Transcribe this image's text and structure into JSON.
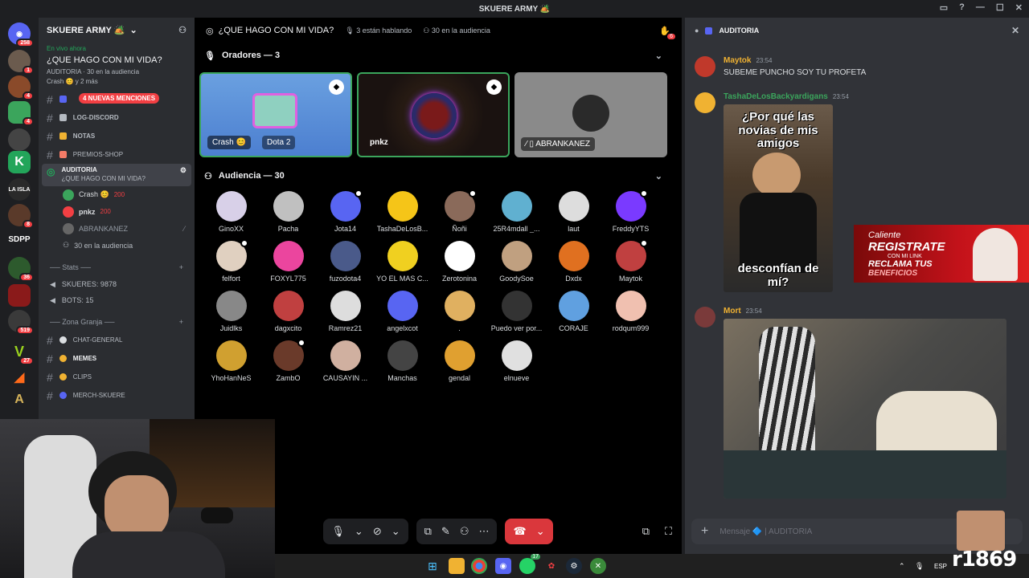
{
  "window": {
    "title": "SKUERE ARMY 🏕️"
  },
  "rail": {
    "badges": [
      "258",
      "1",
      "4",
      "4",
      "8",
      "36",
      "519",
      "27"
    ],
    "sdpp": "SDPP"
  },
  "server": {
    "name": "SKUERE ARMY 🏕️"
  },
  "live": {
    "status": "En vivo ahora",
    "title": "¿QUE HAGO CON MI VIDA?",
    "channel": "AUDITORIA",
    "audience": "30 en la audiencia",
    "speakers": "Crash 😊 y 2 más"
  },
  "channels": {
    "mentions": "4 NUEVAS MENCIONES",
    "items": [
      "LOG-DISCORD",
      "NOTAS",
      "PREMIOS-SHOP"
    ],
    "active": {
      "name": "AUDITORIA",
      "topic": "¿QUE HAGO CON MI VIDA?"
    },
    "voice_users": [
      "Crash 😊",
      "pnkz",
      "ABRANKANEZ"
    ],
    "voice_badges": [
      "200",
      "200"
    ],
    "voice_audience": "30 en la audiencia",
    "cat_stats": "Stats",
    "stats": [
      "SKUERES: 9878",
      "BOTS: 15"
    ],
    "cat_zona": "Zona Granja",
    "zona": [
      "CHAT-GENERAL",
      "MEMES",
      "CLIPS",
      "MERCH-SKUERE"
    ]
  },
  "stage": {
    "title": "¿QUE HAGO CON MI VIDA?",
    "talking": "3 están hablando",
    "audience": "30 en la audiencia",
    "hand_count": "6",
    "speakers_header": "Oradores — 3",
    "speakers": [
      {
        "name": "Crash 😊",
        "extra": "Dota 2"
      },
      {
        "name": "pnkz"
      },
      {
        "name": "ABRANKANEZ"
      }
    ],
    "audience_header": "Audiencia — 30",
    "audience_list": [
      "GinoXX",
      "Pacha",
      "Jota14",
      "TashaDeLosB...",
      "Ñoñi",
      "25R4mdall _...",
      "laut",
      "FreddyYTS",
      "felfort",
      "FOXYL775",
      "fuzodota4",
      "YO EL MAS C...",
      "Zerotonina",
      "GoodySoe",
      "Dxdx",
      "Maytok",
      "Juidlks",
      "dagxcito",
      "Ramrez21",
      "angelxcot",
      ".",
      "Puedo ver por...",
      "CORAJE",
      "rodqum999",
      "YhoHanNeS",
      "ZambO",
      "CAUSAYIN ...",
      "Manchas",
      "gendal",
      "elnueve"
    ]
  },
  "chat": {
    "channel": "AUDITORIA",
    "messages": [
      {
        "user": "Maytok",
        "time": "23:54",
        "text": "SUBEME PUNCHO SOY TU PROFETA",
        "color": "#f0b232"
      },
      {
        "user": "TashaDeLosBackyardigans",
        "time": "23:54",
        "text": "",
        "color": "#3ba55c",
        "meme_top": "¿Por qué las novias de mis amigos",
        "meme_bottom": "desconfían de mí?"
      },
      {
        "user": "Mort",
        "time": "23:54",
        "text": "",
        "color": "#f0b232"
      }
    ],
    "placeholder": "Mensaje 🔷 | AUDITORIA"
  },
  "ad": {
    "line1": "Caliente",
    "line2": "REGISTRATE",
    "line3": "CON MI LINK",
    "line4": "RECLAMA TUS",
    "line5": "BENEFICIOS"
  },
  "taskbar": {
    "lang": "ESP",
    "notif": "17"
  },
  "stamp": "r1869"
}
